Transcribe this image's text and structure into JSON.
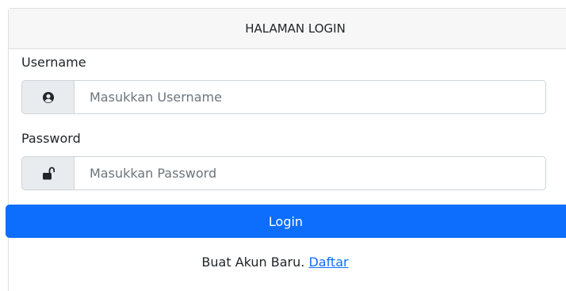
{
  "header": {
    "title": "HALAMAN LOGIN"
  },
  "form": {
    "username": {
      "label": "Username",
      "placeholder": "Masukkan Username",
      "value": "",
      "icon": "user-circle-icon"
    },
    "password": {
      "label": "Password",
      "placeholder": "Masukkan Password",
      "value": "",
      "icon": "unlock-icon"
    },
    "submit_label": "Login"
  },
  "footer": {
    "prompt": "Buat Akun Baru. ",
    "link_label": "Daftar"
  },
  "colors": {
    "primary": "#0d6efd",
    "header_bg": "#f7f7f7",
    "addon_bg": "#e9ecef",
    "border": "#ced4da"
  }
}
